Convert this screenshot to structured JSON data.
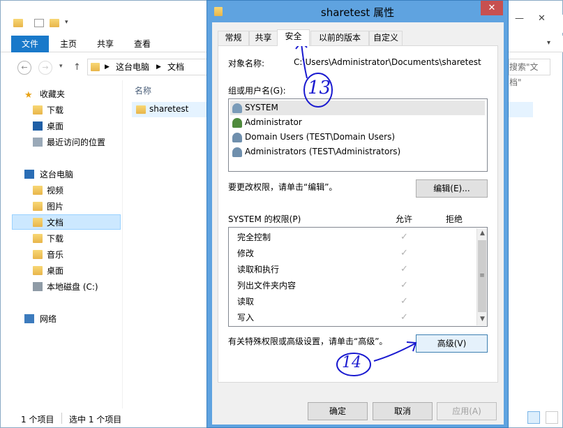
{
  "explorer": {
    "ribbon_tabs": [
      "文件",
      "主页",
      "共享",
      "查看"
    ],
    "breadcrumb": [
      "这台电脑",
      "文档"
    ],
    "search_placeholder": "搜索\"文档\"",
    "column_name": "名称",
    "files": [
      {
        "name": "sharetest"
      }
    ],
    "nav": {
      "favorites": "收藏夹",
      "favorites_items": [
        "下载",
        "桌面",
        "最近访问的位置"
      ],
      "this_pc": "这台电脑",
      "this_pc_items": [
        "视频",
        "图片",
        "文档",
        "下载",
        "音乐",
        "桌面",
        "本地磁盘 (C:)"
      ],
      "network": "网络",
      "selected": "文档"
    },
    "status": {
      "count": "1 个项目",
      "selected": "选中 1 个项目"
    }
  },
  "dialog": {
    "title": "sharetest 属性",
    "close_icon": "close-icon",
    "tabs": [
      "常规",
      "共享",
      "安全",
      "以前的版本",
      "自定义"
    ],
    "active_tab": "安全",
    "object_name_label": "对象名称:",
    "object_name_value": "C:\\Users\\Administrator\\Documents\\sharetest",
    "group_label": "组或用户名(G):",
    "users": [
      {
        "name": "SYSTEM",
        "icon": "group-icon"
      },
      {
        "name": "Administrator",
        "icon": "user-icon"
      },
      {
        "name": "Domain Users (TEST\\Domain Users)",
        "icon": "group-icon"
      },
      {
        "name": "Administrators (TEST\\Administrators)",
        "icon": "group-icon"
      }
    ],
    "edit_hint": "要更改权限，请单击“编辑”。",
    "edit_button": "编辑(E)...",
    "perm_title": "SYSTEM 的权限(P)",
    "allow_header": "允许",
    "deny_header": "拒绝",
    "permissions": [
      {
        "name": "完全控制",
        "allow": true
      },
      {
        "name": "修改",
        "allow": true
      },
      {
        "name": "读取和执行",
        "allow": true
      },
      {
        "name": "列出文件夹内容",
        "allow": true
      },
      {
        "name": "读取",
        "allow": true
      },
      {
        "name": "写入",
        "allow": true
      }
    ],
    "advanced_hint": "有关特殊权限或高级设置，请单击“高级”。",
    "advanced_button": "高级(V)",
    "ok_button": "确定",
    "cancel_button": "取消",
    "apply_button": "应用(A)"
  },
  "annotations": {
    "step13": "13",
    "step14": "14"
  }
}
